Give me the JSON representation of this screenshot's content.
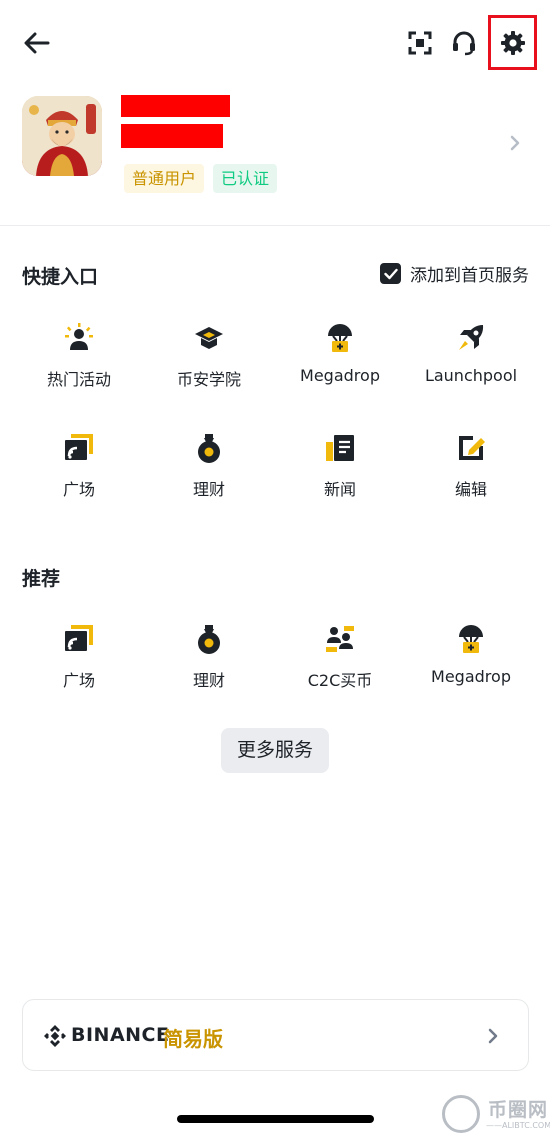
{
  "header": {
    "back_icon": "arrow-left-icon",
    "scan_icon": "scan-icon",
    "support_icon": "headset-icon",
    "settings_icon": "gear-icon",
    "highlight_color": "#e8101c"
  },
  "profile": {
    "badges": {
      "user_type": "普通用户",
      "verified": "已认证"
    },
    "name_redaction_color": "#ff0000"
  },
  "quick_access": {
    "title": "快捷入口",
    "add_to_home_label": "添加到首页服务",
    "add_to_home_checked": true,
    "items": [
      {
        "label": "热门活动",
        "icon": "hot-activity-icon"
      },
      {
        "label": "币安学院",
        "icon": "academy-icon"
      },
      {
        "label": "Megadrop",
        "icon": "megadrop-icon"
      },
      {
        "label": "Launchpool",
        "icon": "launchpool-rocket-icon"
      },
      {
        "label": "广场",
        "icon": "square-feed-icon"
      },
      {
        "label": "理财",
        "icon": "earn-icon"
      },
      {
        "label": "新闻",
        "icon": "news-icon"
      },
      {
        "label": "编辑",
        "icon": "edit-icon"
      }
    ]
  },
  "recommended": {
    "title": "推荐",
    "items": [
      {
        "label": "广场",
        "icon": "square-feed-icon"
      },
      {
        "label": "理财",
        "icon": "earn-icon"
      },
      {
        "label": "C2C买币",
        "icon": "c2c-icon"
      },
      {
        "label": "Megadrop",
        "icon": "megadrop-icon"
      }
    ]
  },
  "more_services": {
    "label": "更多服务"
  },
  "lite": {
    "brand": "BINANCE",
    "edition": "简易版",
    "chevron_icon": "chevron-right-icon"
  },
  "watermark": {
    "text": "币圈网",
    "url": "——ALIBTC.COM——"
  },
  "colors": {
    "accent_yellow": "#f0b90b",
    "dark": "#1e2329",
    "green": "#0ecb81"
  }
}
